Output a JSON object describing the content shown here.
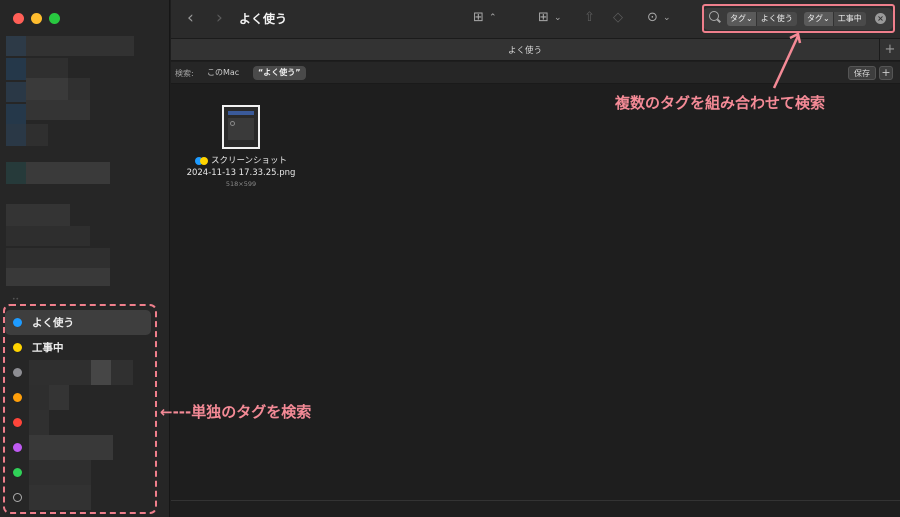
{
  "window": {
    "title": "よく使う"
  },
  "tab": {
    "label": "よく使う"
  },
  "search": {
    "tokens": [
      {
        "key": "タグ⌄",
        "value": "よく使う"
      },
      {
        "key": "タグ⌄",
        "value": "工事中"
      }
    ],
    "clear": "×"
  },
  "toolbar": {
    "back": "‹",
    "forward": "›",
    "view_icon": "⊞",
    "view_arrows": "⌃",
    "group_icon": "⊞",
    "chevron": "⌄",
    "share_icon": "⇧",
    "tag_icon": "◇",
    "more_icon": "⊙",
    "more_chevron": "⌄"
  },
  "scope": {
    "label": "検索:",
    "options": [
      "このMac",
      "“よく使う”"
    ],
    "save": "保存",
    "add": "+"
  },
  "tab_add": "+",
  "files": [
    {
      "name": "スクリーンショット",
      "name2": "2024-11-13 17.33.25.png",
      "dims": "518×599"
    }
  ],
  "sidebar": {
    "tags": [
      {
        "name": "よく使う",
        "color": "#1e9bff",
        "selected": true
      },
      {
        "name": "工事中",
        "color": "#ffd400",
        "selected": false
      },
      {
        "name": "",
        "color": "#8e8e93"
      },
      {
        "name": "",
        "color": "#ff9f0a"
      },
      {
        "name": "",
        "color": "#ff453a"
      },
      {
        "name": "",
        "color": "#bf5af2"
      },
      {
        "name": "",
        "color": "#30d158"
      },
      {
        "name": "",
        "color": "hollow"
      }
    ]
  },
  "annotations": {
    "right": "複数のタグを組み合わせて検索",
    "left": "←---単独のタグを検索"
  },
  "colors": {
    "annotation": "#f48a96",
    "accent": "#1e9bff"
  }
}
